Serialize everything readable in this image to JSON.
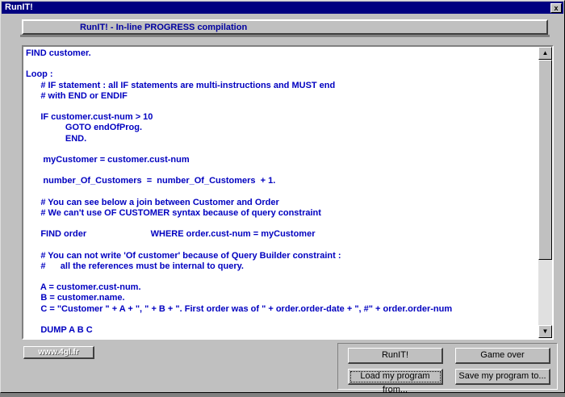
{
  "window": {
    "title": "RunIT!",
    "close_glyph": "x"
  },
  "banner": {
    "text": "RunIT! - In-line PROGRESS compilation"
  },
  "code_lines": [
    "FIND customer.",
    "",
    "Loop :",
    "      # IF statement : all IF statements are multi-instructions and MUST end",
    "      # with END or ENDIF",
    "",
    "      IF customer.cust-num > 10",
    "                GOTO endOfProg.",
    "                END.",
    "",
    "       myCustomer = customer.cust-num",
    "",
    "       number_Of_Customers  =  number_Of_Customers  + 1.",
    "",
    "      # You can see below a join between Customer and Order",
    "      # We can't use OF CUSTOMER syntax because of query constraint",
    "",
    "      FIND order                          WHERE order.cust-num = myCustomer",
    "",
    "      # You can not write 'Of customer' because of Query Builder constraint :",
    "      #      all the references must be internal to query.",
    "",
    "      A = customer.cust-num.",
    "      B = customer.name.",
    "      C = \"Customer \" + A + \", \" + B + \". First order was of \" + order.order-date + \", #\" + order.order-num",
    "",
    "      DUMP A B C",
    ""
  ],
  "logo": {
    "text": "www.4gl.fr"
  },
  "buttons": {
    "runit": "RunIT!",
    "game_over": "Game over",
    "load": "Load my program from...",
    "save": "Save my program to..."
  },
  "icons": {
    "scroll_up": "scroll-up-icon",
    "scroll_down": "scroll-down-icon"
  }
}
